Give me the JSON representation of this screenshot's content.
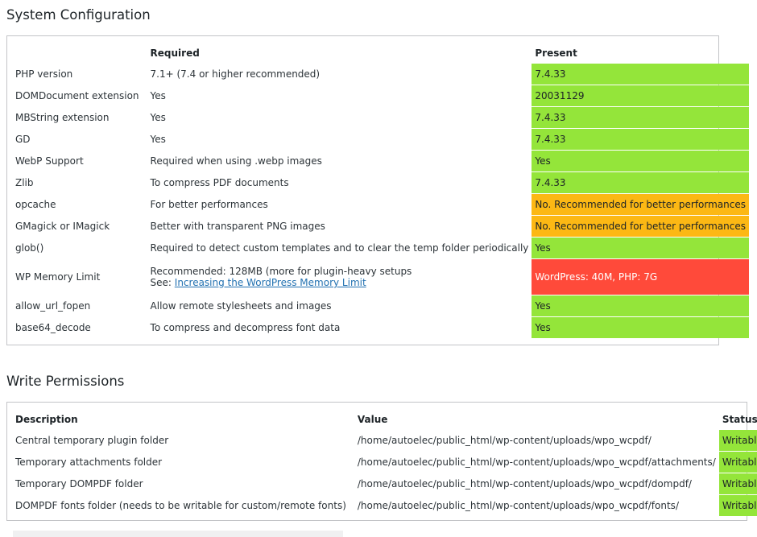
{
  "system": {
    "title": "System Configuration",
    "headers": {
      "name": "",
      "required": "Required",
      "present": "Present"
    },
    "rows": [
      {
        "name": "PHP version",
        "required": "7.1+ (7.4 or higher recommended)",
        "present": "7.4.33",
        "status": "ok"
      },
      {
        "name": "DOMDocument extension",
        "required": "Yes",
        "present": "20031129",
        "status": "ok"
      },
      {
        "name": "MBString extension",
        "required": "Yes",
        "present": "7.4.33",
        "status": "ok"
      },
      {
        "name": "GD",
        "required": "Yes",
        "present": "7.4.33",
        "status": "ok"
      },
      {
        "name": "WebP Support",
        "required": "Required when using .webp images",
        "present": "Yes",
        "status": "ok"
      },
      {
        "name": "Zlib",
        "required": "To compress PDF documents",
        "present": "7.4.33",
        "status": "ok"
      },
      {
        "name": "opcache",
        "required": "For better performances",
        "present": "No. Recommended for better performances",
        "status": "warn"
      },
      {
        "name": "GMagick or IMagick",
        "required": "Better with transparent PNG images",
        "present": "No. Recommended for better performances",
        "status": "warn"
      },
      {
        "name": "glob()",
        "required": "Required to detect custom templates and to clear the temp folder periodically",
        "present": "Yes",
        "status": "ok"
      }
    ],
    "memory_row": {
      "name": "WP Memory Limit",
      "required_line1": "Recommended: 128MB (more for plugin-heavy setups",
      "required_see": "See: ",
      "required_link": "Increasing the WordPress Memory Limit",
      "present": "WordPress: 40M, PHP: 7G",
      "status": "bad"
    },
    "rows_after": [
      {
        "name": "allow_url_fopen",
        "required": "Allow remote stylesheets and images",
        "present": "Yes",
        "status": "ok"
      },
      {
        "name": "base64_decode",
        "required": "To compress and decompress font data",
        "present": "Yes",
        "status": "ok"
      }
    ]
  },
  "permissions": {
    "title": "Write Permissions",
    "headers": {
      "description": "Description",
      "value": "Value",
      "status": "Status"
    },
    "rows": [
      {
        "description": "Central temporary plugin folder",
        "value": "/home/autoelec/public_html/wp-content/uploads/wpo_wcpdf/",
        "status": "Writable"
      },
      {
        "description": "Temporary attachments folder",
        "value": "/home/autoelec/public_html/wp-content/uploads/wpo_wcpdf/attachments/",
        "status": "Writable"
      },
      {
        "description": "Temporary DOMPDF folder",
        "value": "/home/autoelec/public_html/wp-content/uploads/wpo_wcpdf/dompdf/",
        "status": "Writable"
      },
      {
        "description": "DOMPDF fonts folder (needs to be writable for custom/remote fonts)",
        "value": "/home/autoelec/public_html/wp-content/uploads/wpo_wcpdf/fonts/",
        "status": "Writable"
      }
    ]
  },
  "colors": {
    "ok": "#94e53a",
    "warn": "#fcb814",
    "bad": "#ff4a3a"
  }
}
